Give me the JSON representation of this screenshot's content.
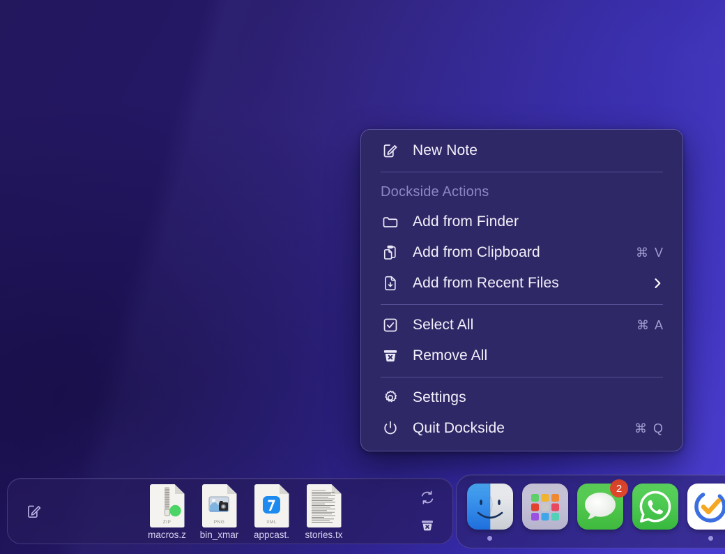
{
  "menu": {
    "items_top": [
      {
        "id": "new-note",
        "label": "New Note",
        "icon": "compose-icon",
        "shortcut": ""
      }
    ],
    "section_title": "Dockside Actions",
    "items_actions": [
      {
        "id": "add-from-finder",
        "label": "Add from Finder",
        "icon": "folder-icon",
        "shortcut": ""
      },
      {
        "id": "add-from-clipboard",
        "label": "Add from Clipboard",
        "icon": "clipboard-icon",
        "shortcut": "⌘ V"
      },
      {
        "id": "add-from-recent-files",
        "label": "Add from Recent Files",
        "icon": "document-down-icon",
        "shortcut": "",
        "submenu": true
      }
    ],
    "items_select": [
      {
        "id": "select-all",
        "label": "Select All",
        "icon": "checkbox-icon",
        "shortcut": "⌘ A"
      },
      {
        "id": "remove-all",
        "label": "Remove All",
        "icon": "trash-x-icon",
        "shortcut": ""
      }
    ],
    "items_app": [
      {
        "id": "settings",
        "label": "Settings",
        "icon": "gear-icon",
        "shortcut": ""
      },
      {
        "id": "quit-dockside",
        "label": "Quit Dockside",
        "icon": "power-icon",
        "shortcut": "⌘ Q"
      }
    ]
  },
  "dockside": {
    "compose_icon": "compose-icon",
    "files": [
      {
        "name": "macros.z",
        "kind": "ZIP",
        "icon": "zip-file-icon",
        "badge_dot": true
      },
      {
        "name": "bin_xmar",
        "kind": "PNG",
        "icon": "png-file-icon",
        "badge_dot": false
      },
      {
        "name": "appcast.",
        "kind": "XML",
        "icon": "xml-file-icon",
        "badge_dot": false
      },
      {
        "name": "stories.tx",
        "kind": "",
        "icon": "text-file-icon",
        "badge_dot": false
      }
    ],
    "tools": [
      {
        "id": "refresh",
        "icon": "refresh-icon"
      },
      {
        "id": "clear",
        "icon": "trash-x-icon"
      }
    ]
  },
  "app_dock": {
    "apps": [
      {
        "id": "finder",
        "label": "Finder",
        "icon": "finder-icon",
        "running": true,
        "badge": ""
      },
      {
        "id": "launchpad",
        "label": "Launchpad",
        "icon": "launchpad-icon",
        "running": false,
        "badge": ""
      },
      {
        "id": "messages",
        "label": "Messages",
        "icon": "messages-icon",
        "running": false,
        "badge": "2"
      },
      {
        "id": "whatsapp",
        "label": "WhatsApp",
        "icon": "whatsapp-icon",
        "running": false,
        "badge": ""
      },
      {
        "id": "reminders",
        "label": "Reminders",
        "icon": "reminders-icon",
        "running": true,
        "badge": ""
      }
    ]
  },
  "colors": {
    "menu_bg": "#2e2866",
    "menu_border": "#5b54a0",
    "menu_text": "#f2f0fb",
    "menu_muted": "#8d86c4",
    "shortcut_text": "#a49ed3",
    "separator": "#565098",
    "badge_red": "#e2472c",
    "running_dot": "#9b92dd",
    "wallpaper_dark": "#23175e",
    "wallpaper_light": "#4436cf"
  }
}
